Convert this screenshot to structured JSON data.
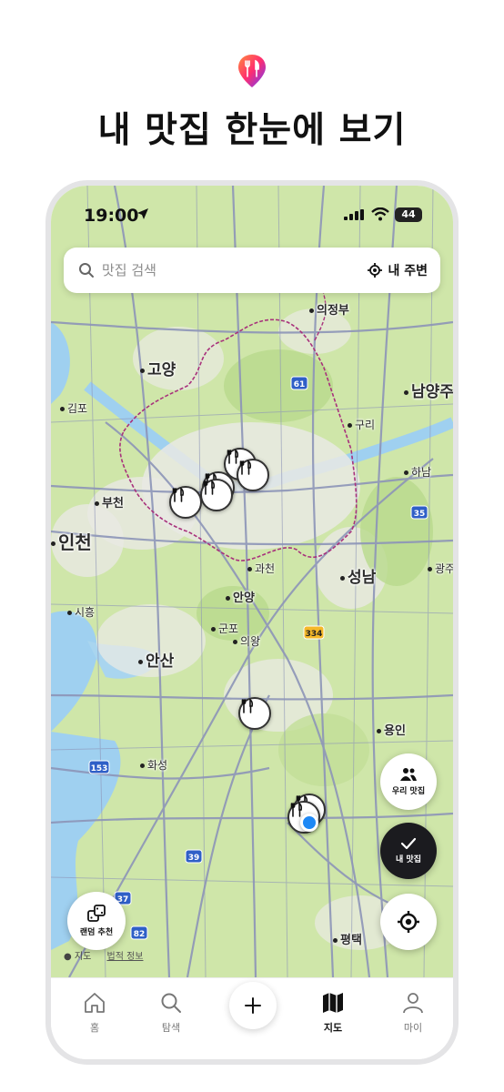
{
  "promo": {
    "title": "내 맛집 한눈에 보기",
    "logo_icon": "fork-knife-pin-icon",
    "brand_gradient": [
      "#ff2d6f",
      "#7a3cff"
    ]
  },
  "status_bar": {
    "time": "19:00",
    "battery": "44"
  },
  "search": {
    "placeholder": "맛집 검색",
    "value": "",
    "nearby_label": "내 주변"
  },
  "map": {
    "cities": [
      {
        "name": "의정부",
        "size": "normal"
      },
      {
        "name": "고양",
        "size": "big"
      },
      {
        "name": "남양주",
        "size": "big"
      },
      {
        "name": "김포",
        "size": "small"
      },
      {
        "name": "구리",
        "size": "small"
      },
      {
        "name": "하남",
        "size": "small"
      },
      {
        "name": "부천",
        "size": "normal"
      },
      {
        "name": "인천",
        "size": "big"
      },
      {
        "name": "과천",
        "size": "small"
      },
      {
        "name": "성남",
        "size": "big"
      },
      {
        "name": "광주",
        "size": "small"
      },
      {
        "name": "안양",
        "size": "normal"
      },
      {
        "name": "시흥",
        "size": "small"
      },
      {
        "name": "군포",
        "size": "small"
      },
      {
        "name": "의왕",
        "size": "small"
      },
      {
        "name": "안산",
        "size": "big"
      },
      {
        "name": "용인",
        "size": "normal"
      },
      {
        "name": "화성",
        "size": "small"
      },
      {
        "name": "평택",
        "size": "normal"
      }
    ],
    "route_shields": [
      "61",
      "35",
      "334",
      "153",
      "39",
      "37",
      "82"
    ],
    "credit_brand": "지도",
    "credit_legal": "법적 정보",
    "colors": {
      "land": "#cfe6a9",
      "water": "#9fd0f0",
      "urban": "#e9e9e4",
      "road": "#8d95b8",
      "boundary": "#a8317c"
    }
  },
  "fabs": {
    "our_places": "우리 맛집",
    "my_places": "내 맛집",
    "random": "랜덤 추천"
  },
  "tabs": [
    {
      "label": "홈",
      "icon": "home-icon",
      "active": false
    },
    {
      "label": "탐색",
      "icon": "search-icon",
      "active": false
    },
    {
      "label": "지도",
      "icon": "map-icon",
      "active": true
    },
    {
      "label": "마이",
      "icon": "person-icon",
      "active": false
    }
  ]
}
